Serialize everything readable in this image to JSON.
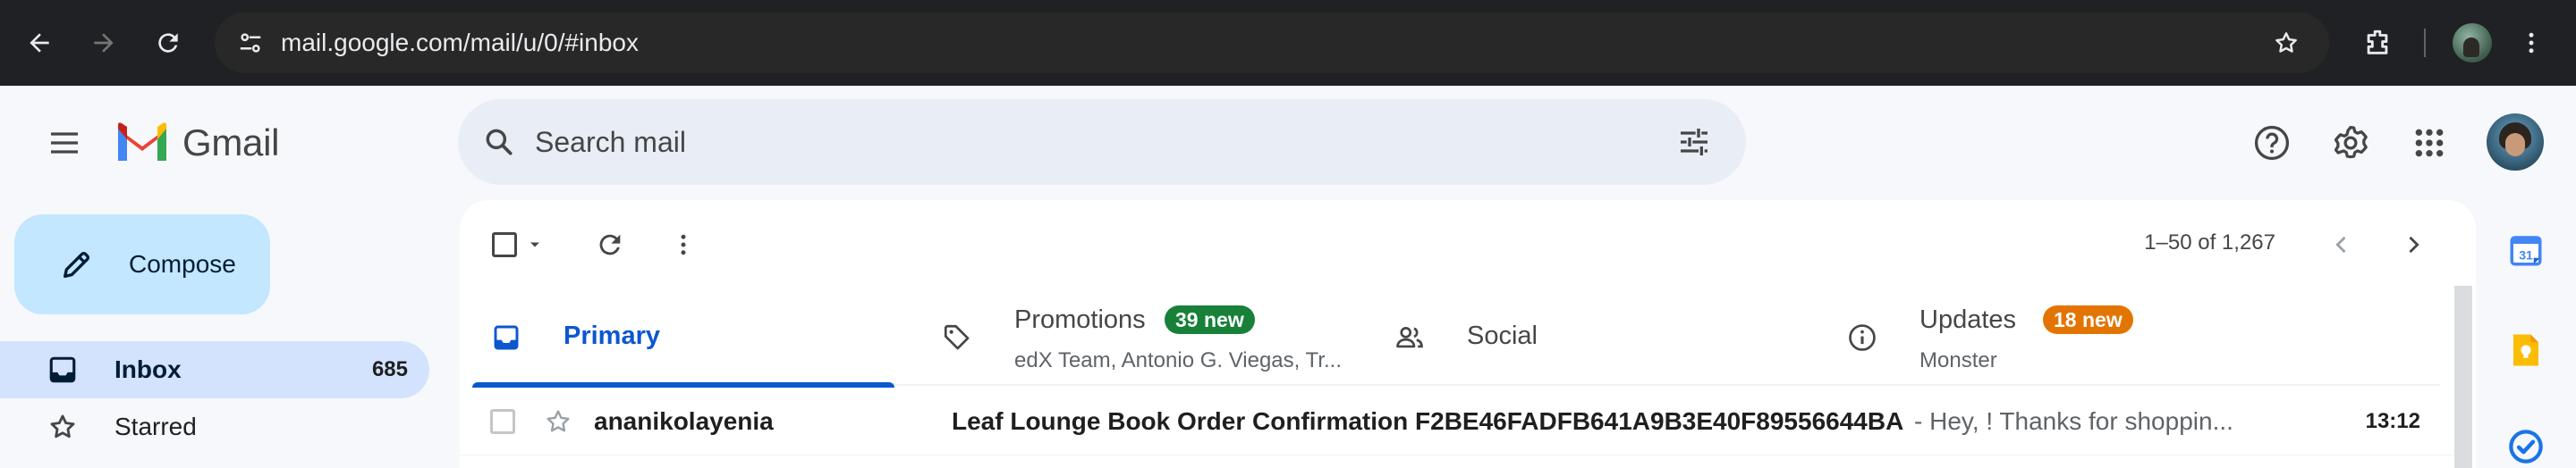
{
  "browser": {
    "url": "mail.google.com/mail/u/0/#inbox",
    "icons": [
      "back-arrow-icon",
      "forward-arrow-icon",
      "reload-icon",
      "site-info-icon",
      "bookmark-star-icon",
      "extensions-icon",
      "profile-avatar",
      "more-vert-icon"
    ]
  },
  "header": {
    "logo_text": "Gmail",
    "search_placeholder": "Search mail",
    "icons": [
      "menu-icon",
      "search-icon",
      "search-options-icon",
      "help-icon",
      "settings-icon",
      "apps-grid-icon",
      "account-avatar"
    ]
  },
  "sidebar": {
    "compose_label": "Compose",
    "items": [
      {
        "label": "Inbox",
        "count": "685",
        "icon": "inbox-icon",
        "active": true
      },
      {
        "label": "Starred",
        "count": "",
        "icon": "star-icon",
        "active": false
      }
    ]
  },
  "toolbar": {
    "pager": "1–50 of 1,267",
    "icons": [
      "select-checkbox",
      "select-dropdown-icon",
      "refresh-icon",
      "more-vert-icon",
      "prev-page-icon",
      "next-page-icon"
    ]
  },
  "tabs": [
    {
      "label": "Primary",
      "active": true,
      "icon": "inbox-tab-icon",
      "badge": "",
      "sub": ""
    },
    {
      "label": "Promotions",
      "active": false,
      "icon": "tag-icon",
      "badge": "39 new",
      "badge_color": "#188038",
      "sub": "edX Team, Antonio G. Viegas, Tr..."
    },
    {
      "label": "Social",
      "active": false,
      "icon": "people-icon",
      "badge": "",
      "sub": ""
    },
    {
      "label": "Updates",
      "active": false,
      "icon": "info-icon",
      "badge": "18 new",
      "badge_color": "#e37400",
      "sub": "Monster"
    }
  ],
  "emails": [
    {
      "sender": "ananikolayenia",
      "subject": "Leaf Lounge Book Order Confirmation F2BE46FADFB641A9B3E40F89556644BA",
      "snippet": "- Hey, ! Thanks for shoppin...",
      "time": "13:12"
    }
  ],
  "side_panel": {
    "icons": [
      "calendar-icon",
      "keep-icon",
      "tasks-icon"
    ],
    "calendar_day": "31"
  },
  "colors": {
    "accent": "#0b57d0",
    "compose_bg": "#c2e7ff",
    "active_nav_bg": "#d3e3fd",
    "promotions_badge": "#188038",
    "updates_badge": "#e37400"
  }
}
